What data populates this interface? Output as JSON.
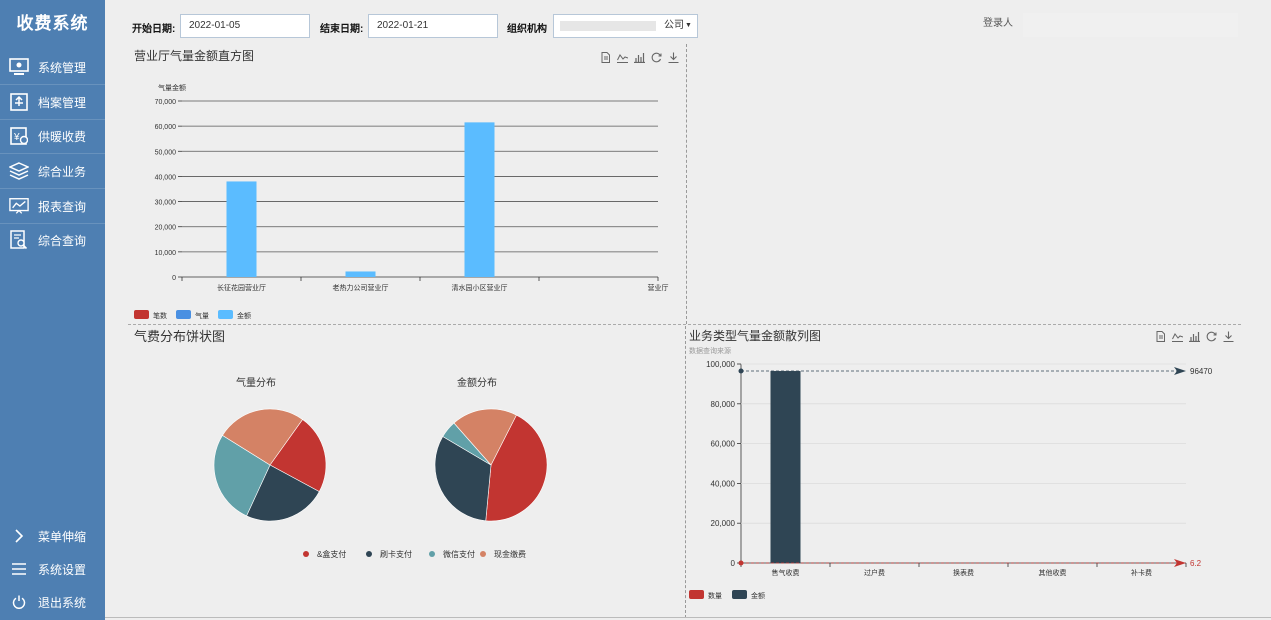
{
  "sidebar": {
    "title": "收费系统",
    "items": [
      {
        "label": "系统管理",
        "icon": "monitor-icon"
      },
      {
        "label": "档案管理",
        "icon": "archive-icon"
      },
      {
        "label": "供暖收费",
        "icon": "billing-icon"
      },
      {
        "label": "综合业务",
        "icon": "layers-icon"
      },
      {
        "label": "报表查询",
        "icon": "report-chart-icon"
      },
      {
        "label": "综合查询",
        "icon": "search-document-icon"
      }
    ],
    "bottom_items": [
      {
        "label": "菜单伸缩",
        "icon": "chevron-right-icon"
      },
      {
        "label": "系统设置",
        "icon": "menu-lines-icon"
      },
      {
        "label": "退出系统",
        "icon": "power-icon"
      }
    ]
  },
  "filters": {
    "start_label": "开始日期:",
    "start_value": "2022-01-05",
    "end_label": "结束日期:",
    "end_value": "2022-01-21",
    "org_label": "组织机构",
    "org_value": "公司",
    "login_label": "登录人"
  },
  "colors": {
    "sidebar": "#4e7fb2",
    "red": "#c23531",
    "dark": "#2f4554",
    "teal": "#61a0a8",
    "orange": "#d48265",
    "blue_bar": "#5bbcff",
    "blue_legend": "#4a90e2"
  },
  "panels": {
    "histogram": {
      "title": "营业厅气量金额直方图"
    },
    "pies": {
      "title": "气费分布饼状图"
    },
    "scatter": {
      "title": "业务类型气量金额散列图"
    }
  },
  "chart_data": [
    {
      "type": "bar",
      "title": "营业厅气量金额直方图",
      "ylabel": "气量金额",
      "ylim": [
        0,
        70000
      ],
      "yticks": [
        "0",
        "10,000",
        "20,000",
        "30,000",
        "40,000",
        "50,000",
        "60,000",
        "70,000"
      ],
      "categories": [
        "长征花园营业厅",
        "老热力公司营业厅",
        "清水园小区营业厅",
        "营业厅"
      ],
      "series": [
        {
          "name": "笔数",
          "color": "#c23531",
          "values": [
            0,
            0,
            0,
            0
          ]
        },
        {
          "name": "气量",
          "color": "#4a90e2",
          "values": [
            0,
            0,
            0,
            0
          ]
        },
        {
          "name": "金额",
          "color": "#5bbcff",
          "values": [
            38000,
            2200,
            61500,
            0
          ]
        }
      ],
      "legend": "bottom-left",
      "grid": true
    },
    {
      "type": "pie",
      "title": "气量分布",
      "slices": [
        {
          "name": "&盒支付",
          "value": 23,
          "color": "#c23531"
        },
        {
          "name": "刷卡支付",
          "value": 24,
          "color": "#2f4554"
        },
        {
          "name": "微信支付",
          "value": 27,
          "color": "#61a0a8"
        },
        {
          "name": "现金缴费",
          "value": 26,
          "color": "#d48265"
        }
      ]
    },
    {
      "type": "pie",
      "title": "金额分布",
      "slices": [
        {
          "name": "&盒支付",
          "value": 44,
          "color": "#c23531"
        },
        {
          "name": "刷卡支付",
          "value": 32,
          "color": "#2f4554"
        },
        {
          "name": "微信支付",
          "value": 5,
          "color": "#61a0a8"
        },
        {
          "name": "现金缴费",
          "value": 19,
          "color": "#d48265"
        }
      ],
      "legend": [
        "&盒支付",
        "刷卡支付",
        "微信支付",
        "现金缴费"
      ]
    },
    {
      "type": "bar",
      "title": "业务类型气量金额散列图",
      "subtitle": "数据查询来源",
      "ylim": [
        0,
        100000
      ],
      "yticks": [
        "0",
        "20,000",
        "40,000",
        "60,000",
        "80,000",
        "100,000"
      ],
      "categories": [
        "售气收费",
        "过户费",
        "换表费",
        "其他收费",
        "补卡费"
      ],
      "series": [
        {
          "name": "数量",
          "color": "#c23531",
          "values": [
            6.2,
            0,
            0,
            0,
            0
          ]
        },
        {
          "name": "金额",
          "color": "#2f4554",
          "values": [
            96470,
            0,
            0,
            0,
            0
          ]
        }
      ],
      "markers": [
        {
          "label": "96470",
          "color": "#2f4554"
        },
        {
          "label": "6.2",
          "color": "#c23531"
        }
      ],
      "legend": "bottom-left",
      "grid": true
    }
  ]
}
